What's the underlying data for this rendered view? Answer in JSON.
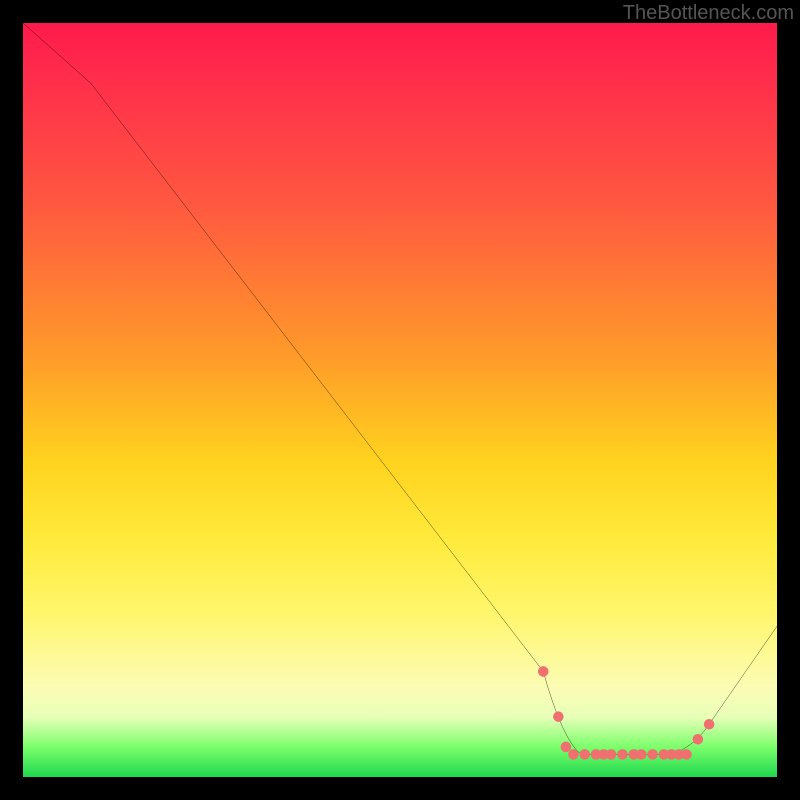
{
  "attribution": "TheBottleneck.com",
  "colors": {
    "gradient_top": "#ff1a4b",
    "gradient_mid_orange": "#ff9a2a",
    "gradient_yellow": "#ffe93a",
    "gradient_green": "#1fd84e",
    "curve": "#000000",
    "dot": "#f07070",
    "frame": "#000000"
  },
  "chart_data": {
    "type": "line",
    "title": "",
    "xlabel": "",
    "ylabel": "",
    "xlim": [
      0,
      100
    ],
    "ylim": [
      0,
      100
    ],
    "series": [
      {
        "name": "bottleneck-curve",
        "x": [
          0,
          9,
          69,
          72,
          88,
          91,
          100
        ],
        "y": [
          100,
          92,
          14,
          3,
          3,
          7,
          20
        ]
      }
    ],
    "markers": {
      "name": "highlight-dots",
      "x": [
        69,
        71,
        72,
        73,
        74.5,
        76,
        77,
        78,
        79.5,
        81,
        82,
        83.5,
        85,
        86,
        87,
        88,
        89.5,
        91
      ],
      "y": [
        14,
        8,
        4,
        3,
        3,
        3,
        3,
        3,
        3,
        3,
        3,
        3,
        3,
        3,
        3,
        3,
        5,
        7
      ]
    }
  }
}
